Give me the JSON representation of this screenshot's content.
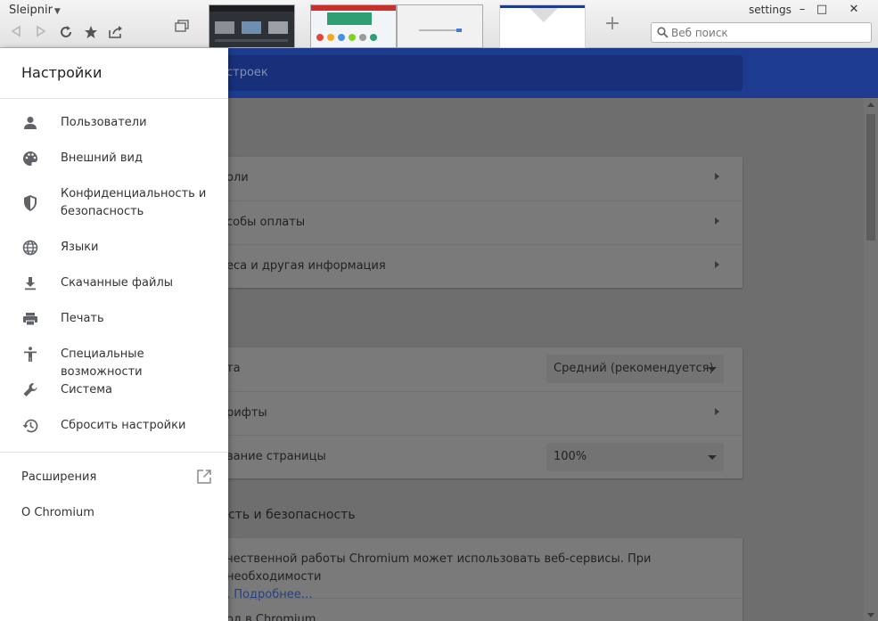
{
  "browser": {
    "brand": "Sleipnir",
    "window_title": "settings",
    "search_placeholder": "Веб поиск",
    "new_tab": "+",
    "minimize": "–",
    "maximize": "□",
    "close": "✕"
  },
  "page": {
    "header_search_text": "строек",
    "autofill_rows": [
      "оли",
      "собы оплаты",
      "еса и другая информация"
    ],
    "appearance_rows": [
      {
        "label": "та",
        "value": "Средний (рекомендуется)"
      },
      {
        "label": "рифты"
      },
      {
        "label": "вание страницы",
        "value": "100%"
      }
    ],
    "privacy_title": "ьность и безопасность",
    "privacy_desc": "чественной работы Chromium может использовать веб-сервисы. При необходимости",
    "privacy_desc_line2": ". ",
    "privacy_link": "Подробнее…",
    "privacy_row2": "од в Chromium"
  },
  "drawer": {
    "title": "Настройки",
    "items": [
      {
        "label": "Пользователи",
        "icon": "person-icon"
      },
      {
        "label": "Внешний вид",
        "icon": "palette-icon"
      },
      {
        "label": "Конфиденциальность и",
        "label2": "безопасность",
        "icon": "shield-icon"
      },
      {
        "label": "Языки",
        "icon": "globe-icon"
      },
      {
        "label": "Скачанные файлы",
        "icon": "download-icon"
      },
      {
        "label": "Печать",
        "icon": "printer-icon"
      },
      {
        "label": "Специальные возможности",
        "icon": "accessibility-icon"
      },
      {
        "label": "Система",
        "icon": "wrench-icon"
      },
      {
        "label": "Сбросить настройки",
        "icon": "history-icon"
      }
    ],
    "extensions": "Расширения",
    "about": "О Chromium"
  },
  "colors": {
    "header_blue": "#1d3c8f",
    "drawer_bg": "#ffffff",
    "overlay": "#6e6e6e"
  }
}
